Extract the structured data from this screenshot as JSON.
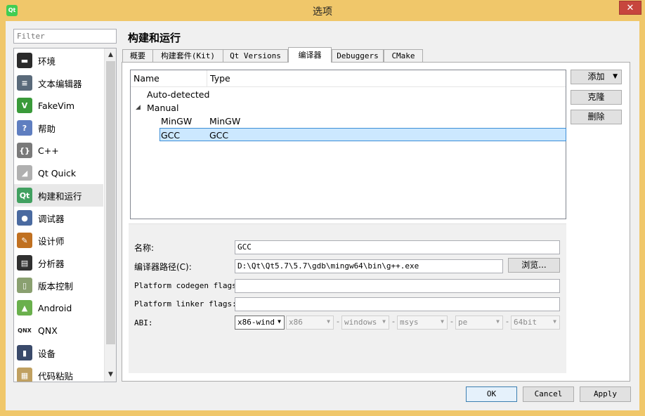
{
  "window": {
    "title": "选项",
    "app_icon_text": "Qt",
    "close_glyph": "✕"
  },
  "filter": {
    "placeholder": "Filter"
  },
  "nav": {
    "items": [
      {
        "label": "环境",
        "icon": "environment-icon",
        "glyph": "▬",
        "color": "#2b2b2b"
      },
      {
        "label": "文本编辑器",
        "icon": "text-editor-icon",
        "glyph": "≡",
        "color": "#5a6a7a"
      },
      {
        "label": "FakeVim",
        "icon": "fakevim-icon",
        "glyph": "V",
        "color": "#3a9a3a"
      },
      {
        "label": "帮助",
        "icon": "help-icon",
        "glyph": "?",
        "color": "#5f7ec0"
      },
      {
        "label": "C++",
        "icon": "cpp-icon",
        "glyph": "{}",
        "color": "#7a7a7a"
      },
      {
        "label": "Qt Quick",
        "icon": "qt-quick-icon",
        "glyph": "◢",
        "color": "#b0b0b0"
      },
      {
        "label": "构建和运行",
        "icon": "build-run-icon",
        "glyph": "Qt",
        "color": "#41a060"
      },
      {
        "label": "调试器",
        "icon": "debugger-icon",
        "glyph": "●",
        "color": "#4a6aa0"
      },
      {
        "label": "设计师",
        "icon": "designer-icon",
        "glyph": "✎",
        "color": "#c07020"
      },
      {
        "label": "分析器",
        "icon": "analyzer-icon",
        "glyph": "▤",
        "color": "#303030"
      },
      {
        "label": "版本控制",
        "icon": "version-control-icon",
        "glyph": "▯",
        "color": "#8aa070"
      },
      {
        "label": "Android",
        "icon": "android-icon",
        "glyph": "▲",
        "color": "#6ab04c"
      },
      {
        "label": "QNX",
        "icon": "qnx-icon",
        "glyph": "QNX",
        "color": "#ffffff"
      },
      {
        "label": "设备",
        "icon": "devices-icon",
        "glyph": "▮",
        "color": "#3a4a6a"
      },
      {
        "label": "代码粘贴",
        "icon": "code-paste-icon",
        "glyph": "▦",
        "color": "#c0a060"
      }
    ],
    "selected_index": 6
  },
  "page": {
    "title": "构建和运行"
  },
  "tabs": [
    {
      "label": "概要"
    },
    {
      "label": "构建套件(Kit)"
    },
    {
      "label": "Qt Versions"
    },
    {
      "label": "编译器"
    },
    {
      "label": "Debuggers"
    },
    {
      "label": "CMake"
    }
  ],
  "active_tab": 3,
  "tree": {
    "columns": [
      "Name",
      "Type"
    ],
    "rows": [
      {
        "name": "Auto-detected",
        "type": ""
      },
      {
        "name": "Manual",
        "type": ""
      },
      {
        "name": "MinGW",
        "type": "MinGW"
      },
      {
        "name": "GCC",
        "type": "GCC"
      }
    ],
    "expander_glyph": "◢",
    "selected": "GCC"
  },
  "actions": {
    "add": "添加",
    "clone": "克隆",
    "remove": "删除",
    "dropdown_glyph": "▼"
  },
  "details": {
    "name_label": "名称:",
    "name_value": "GCC",
    "path_label": "编译器路径(C):",
    "path_value": "D:\\Qt\\Qt5.7\\5.7\\gdb\\mingw64\\bin\\g++.exe",
    "browse": "浏览...",
    "codegen_label": "Platform codegen flags:",
    "codegen_value": "",
    "linker_label": "Platform linker flags:",
    "linker_value": "",
    "abi_label": "ABI:",
    "abi": {
      "preset": "x86-wind",
      "arch": "x86",
      "os": "windows",
      "flavor": "msys",
      "format": "pe",
      "width": "64bit"
    },
    "sep": "-"
  },
  "buttons": {
    "ok": "OK",
    "cancel": "Cancel",
    "apply": "Apply"
  },
  "colors": {
    "title_bar": "#f0c76a",
    "close": "#c7463d",
    "selection": "#cce8ff",
    "selection_border": "#3c8ed6"
  }
}
